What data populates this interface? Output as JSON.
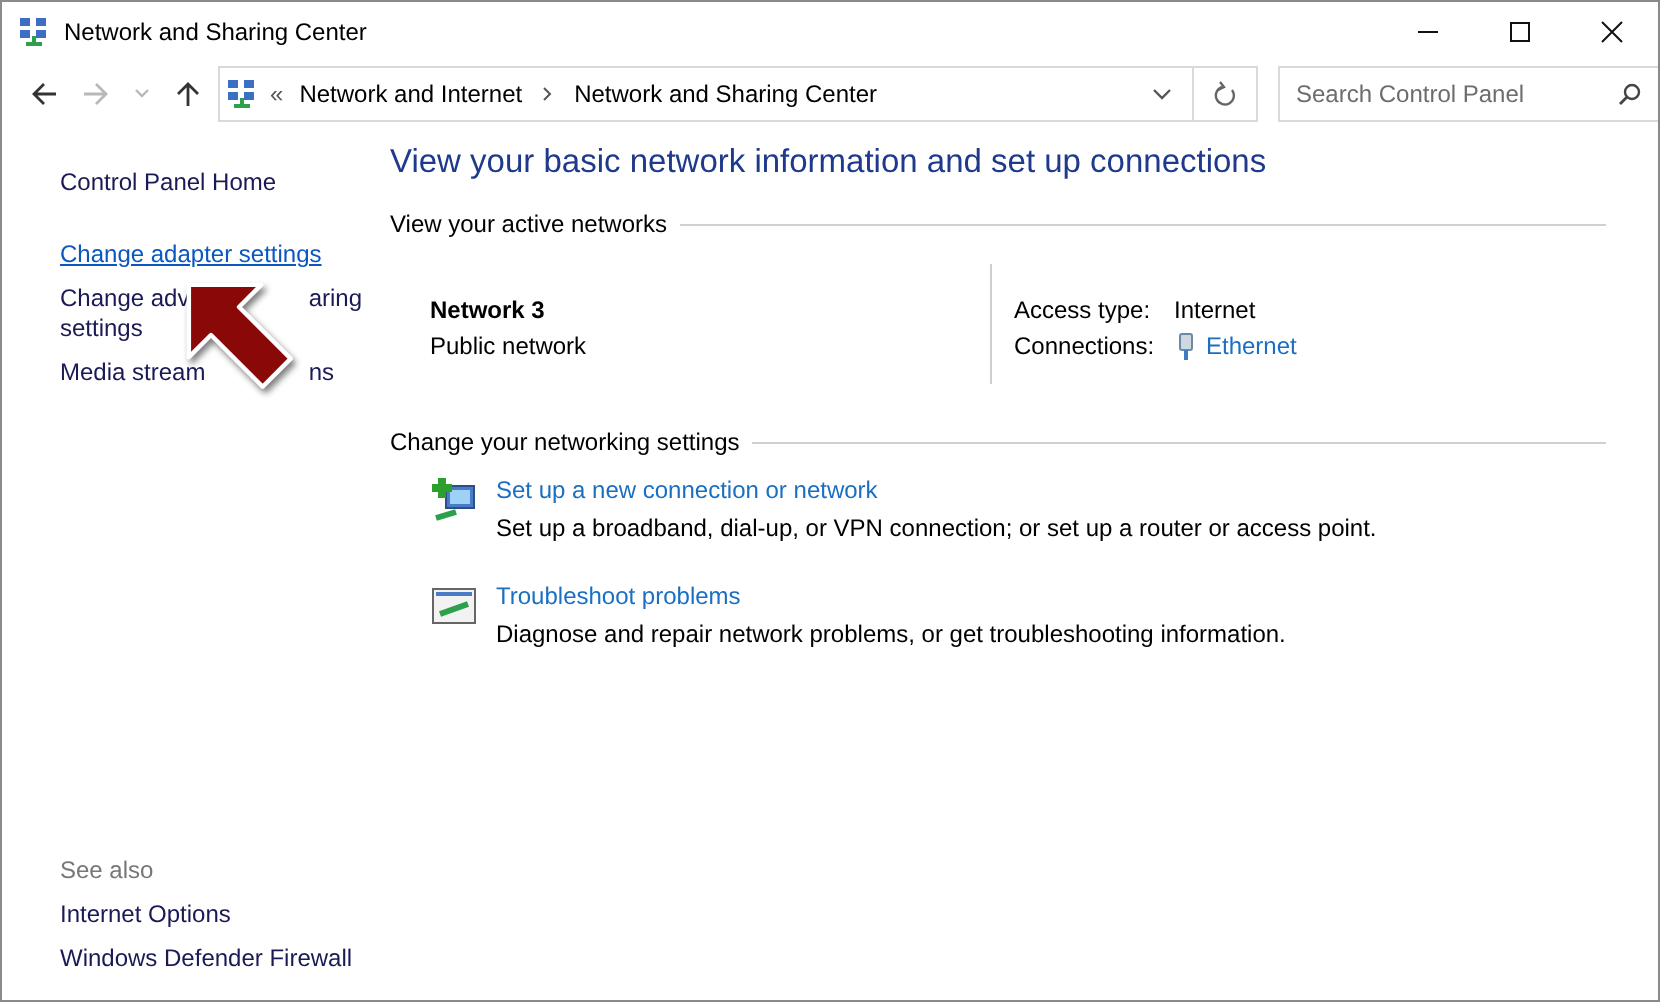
{
  "window": {
    "title": "Network and Sharing Center"
  },
  "nav_buttons": [
    {
      "kind": "back",
      "disabled": false
    },
    {
      "kind": "forward",
      "disabled": true
    },
    {
      "kind": "recent",
      "disabled": true
    },
    {
      "kind": "up",
      "disabled": false
    }
  ],
  "address": {
    "overflow": "«",
    "crumbs": [
      "Network and Internet",
      "Network and Sharing Center"
    ]
  },
  "search": {
    "placeholder": "Search Control Panel"
  },
  "sidebar": {
    "items": [
      {
        "lines": [
          [
            "Control Panel Home"
          ]
        ],
        "hovered": false
      },
      {
        "lines": [
          [
            "Change adapter settings"
          ]
        ],
        "hovered": true
      },
      {
        "lines": [
          [
            "Change adv",
            "aring"
          ],
          [
            "settings"
          ]
        ],
        "hovered": false
      },
      {
        "lines": [
          [
            "Media stream",
            "ns"
          ]
        ],
        "hovered": false
      }
    ],
    "see_also": {
      "heading": "See also",
      "items": [
        "Internet Options",
        "Windows Defender Firewall"
      ]
    }
  },
  "main": {
    "heading": "View your basic network information and set up connections",
    "active_networks": {
      "heading": "View your active networks",
      "network": {
        "name": "Network 3",
        "category": "Public network"
      },
      "access_type": {
        "label": "Access type:",
        "value": "Internet"
      },
      "connections": {
        "label": "Connections:",
        "value": "Ethernet"
      }
    },
    "settings": {
      "heading": "Change your networking settings",
      "tasks": [
        {
          "kind": "setup",
          "title": "Set up a new connection or network",
          "description": "Set up a broadband, dial-up, or VPN connection; or set up a router or access point."
        },
        {
          "kind": "troubleshoot",
          "title": "Troubleshoot problems",
          "description": "Diagnose and repair network problems, or get troubleshooting information."
        }
      ]
    }
  }
}
